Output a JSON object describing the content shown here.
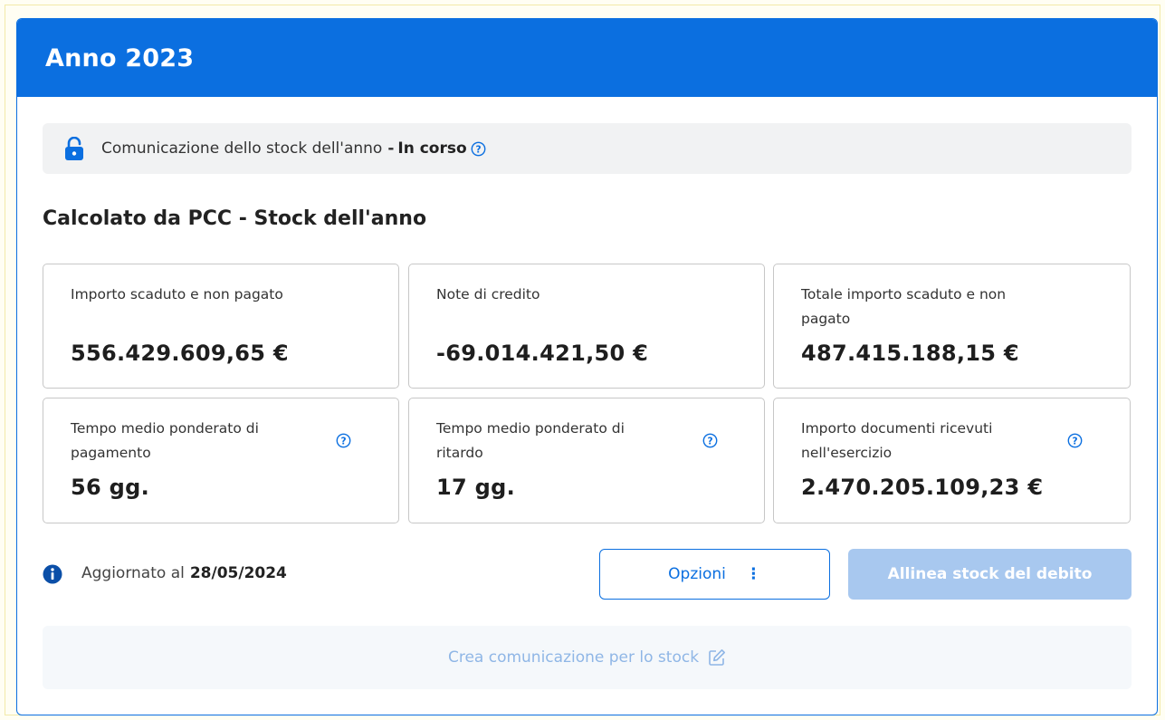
{
  "header": {
    "title": "Anno 2023"
  },
  "status": {
    "lock_icon": "lock-open-icon",
    "text": "Comunicazione dello stock dell'anno",
    "separator": "-",
    "value": "In corso"
  },
  "section": {
    "title": "Calcolato da PCC - Stock dell'anno"
  },
  "tiles": [
    {
      "label": "Importo scaduto e non pagato",
      "value": "556.429.609,65 €"
    },
    {
      "label": "Note di credito",
      "value": "-69.014.421,50 €"
    },
    {
      "label_line1": "Totale importo scaduto e non",
      "label_line2": "pagato",
      "value": "487.415.188,15 €"
    },
    {
      "label_line1": "Tempo medio ponderato di",
      "label_line2": "pagamento",
      "value": "56 gg."
    },
    {
      "label_line1": "Tempo medio ponderato di",
      "label_line2": "ritardo",
      "value": "17 gg."
    },
    {
      "label_line1": "Importo documenti ricevuti",
      "label_line2": "nell'esercizio",
      "value": "2.470.205.109,23 €"
    }
  ],
  "footer": {
    "updated_label": "Aggiornato al",
    "updated_date": "28/05/2024",
    "options_label": "Opzioni",
    "options_kebab": "⋮",
    "align_label": "Allinea stock del debito"
  },
  "create": {
    "label": "Crea comunicazione per lo stock"
  },
  "colors": {
    "primary": "#0b6fe0",
    "disabled_button": "#a8c8ef",
    "create_text": "#8fb6e6"
  }
}
